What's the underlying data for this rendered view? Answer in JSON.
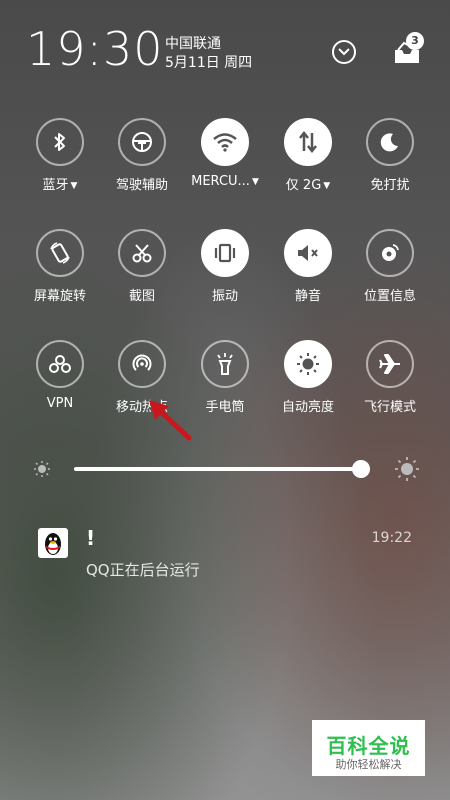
{
  "status": {
    "time": "19:30",
    "carrier": "中国联通",
    "date": "5月11日 周四",
    "notification_count": "3"
  },
  "tiles": [
    {
      "label": "蓝牙",
      "caret": true,
      "on": false,
      "icon": "bluetooth-icon"
    },
    {
      "label": "驾驶辅助",
      "caret": false,
      "on": false,
      "icon": "steering-wheel-icon"
    },
    {
      "label": "MERCU...",
      "caret": true,
      "on": true,
      "icon": "wifi-icon"
    },
    {
      "label": "仅 2G",
      "caret": true,
      "on": true,
      "icon": "mobile-data-icon"
    },
    {
      "label": "免打扰",
      "caret": false,
      "on": false,
      "icon": "moon-icon"
    },
    {
      "label": "屏幕旋转",
      "caret": false,
      "on": false,
      "icon": "rotate-icon"
    },
    {
      "label": "截图",
      "caret": false,
      "on": false,
      "icon": "scissors-icon"
    },
    {
      "label": "振动",
      "caret": false,
      "on": true,
      "icon": "vibrate-icon"
    },
    {
      "label": "静音",
      "caret": false,
      "on": true,
      "icon": "mute-icon"
    },
    {
      "label": "位置信息",
      "caret": false,
      "on": false,
      "icon": "location-icon"
    },
    {
      "label": "VPN",
      "caret": false,
      "on": false,
      "icon": "vpn-icon"
    },
    {
      "label": "移动热点",
      "caret": false,
      "on": false,
      "icon": "hotspot-icon"
    },
    {
      "label": "手电筒",
      "caret": false,
      "on": false,
      "icon": "flashlight-icon"
    },
    {
      "label": "自动亮度",
      "caret": false,
      "on": true,
      "icon": "auto-brightness-icon"
    },
    {
      "label": "飞行模式",
      "caret": false,
      "on": false,
      "icon": "airplane-icon"
    }
  ],
  "brightness": {
    "level": 0.97
  },
  "notification": {
    "title": "!",
    "time": "19:22",
    "body": "QQ正在后台运行",
    "app_icon": "qq-penguin-icon"
  },
  "watermark": {
    "title": "百科全说",
    "subtitle": "助你轻松解决"
  },
  "colors": {
    "tile_on": "#ffffff",
    "tile_icon_dark": "#555555",
    "annotation_arrow": "#c8181e",
    "watermark_green": "#2fbf4e"
  }
}
